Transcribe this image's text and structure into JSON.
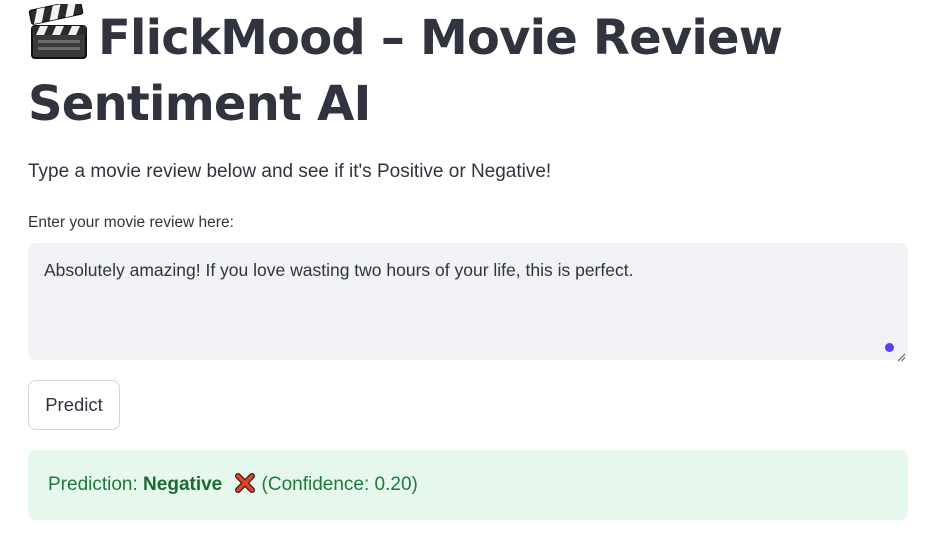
{
  "header": {
    "title_icon": "clapperboard-icon",
    "title": "FlickMood – Movie Review Sentiment AI"
  },
  "intro": {
    "text": "Type a movie review below and see if it's Positive or Negative!"
  },
  "review_input": {
    "label": "Enter your movie review here:",
    "value": "Absolutely amazing! If you love wasting two hours of your life, this is perfect."
  },
  "actions": {
    "predict_label": "Predict"
  },
  "result": {
    "prefix": "Prediction: ",
    "label": "Negative",
    "icon": "cross-mark-icon",
    "confidence_text": "(Confidence: 0.20)"
  },
  "colors": {
    "text": "#31333f",
    "input_bg": "#f0f2f6",
    "focus_accent": "#5b3df5",
    "success_bg": "#e6f7ec",
    "success_text": "#1e7a3c",
    "cross_red": "#e0452b"
  }
}
